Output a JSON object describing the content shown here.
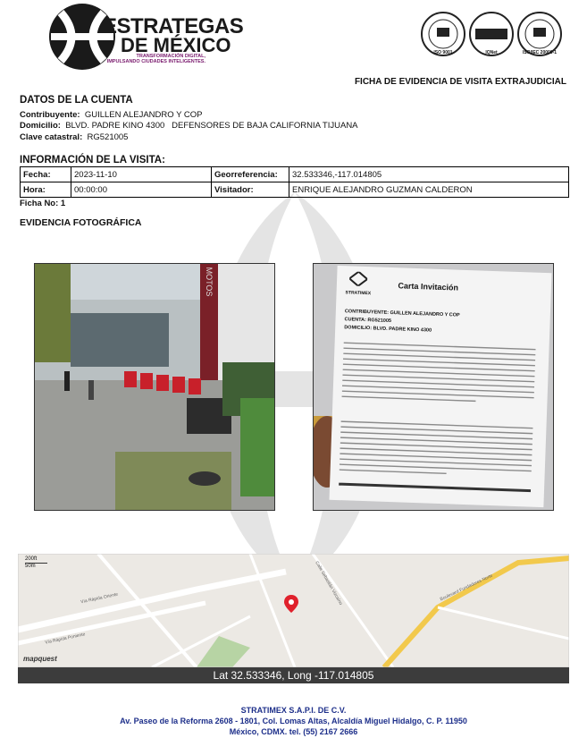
{
  "header": {
    "brand_line1": "ESTRATEGAS",
    "brand_line2": "DE MÉXICO",
    "brand_tagline": "TRANSFORMACIÓN DIGITAL, IMPULSANDO CIUDADES INTELIGENTES.",
    "certifications": [
      "ISO 9001",
      "IQNet",
      "ISO/IEC 20000-1"
    ],
    "document_title": "FICHA DE EVIDENCIA DE VISITA EXTRAJUDICIAL"
  },
  "account": {
    "section_title": "DATOS DE LA CUENTA",
    "contribuyente_label": "Contribuyente:",
    "contribuyente_value": "GUILLEN ALEJANDRO Y COP",
    "domicilio_label": "Domicilio:",
    "domicilio_value": "BLVD. PADRE KINO 4300   DEFENSORES DE BAJA CALIFORNIA TIJUANA",
    "clave_label": "Clave catastral:",
    "clave_value": "RG521005"
  },
  "visit": {
    "section_title": "INFORMACIÓN DE LA VISITA:",
    "fecha_label": "Fecha:",
    "fecha_value": "2023-11-10",
    "georef_label": "Georreferencia:",
    "georef_value": "32.533346,-117.014805",
    "hora_label": "Hora:",
    "hora_value": "00:00:00",
    "visitador_label": "Visitador:",
    "visitador_value": "ENRIQUE ALEJANDRO GUZMAN CALDERON",
    "ficha_no": "Ficha No: 1"
  },
  "evidence": {
    "section_title": "EVIDENCIA FOTOGRÁFICA",
    "letter": {
      "brand": "STRATIMEX",
      "title": "Carta Invitación",
      "contribuyente": "CONTRIBUYENTE: GUILLEN ALEJANDRO Y COP",
      "cuenta": "CUENTA: RG521005",
      "domicilio": "DOMICILIO: BLVD. PADRE KINO 4300"
    },
    "storefront_sign": "MOTOS"
  },
  "map": {
    "scale_ft": "200ft",
    "scale_m": "50m",
    "provider": "mapquest",
    "caption": "Lat 32.533346, Long -117.014805",
    "streets": [
      "Vía Rápida Oriente",
      "Vía Rápida Poniente",
      "Boulevard Fundadores Norte",
      "Calle Sebastián Vizcaíno"
    ],
    "pin_color": "#e0212c"
  },
  "footer": {
    "company": "STRATIMEX S.A.P.I. DE C.V.",
    "address": "Av. Paseo de la Reforma 2608 - 1801, Col. Lomas Altas, Alcaldía Miguel Hidalgo, C. P. 11950",
    "city_phone": "México, CDMX. tel. (55) 2167 2666"
  }
}
